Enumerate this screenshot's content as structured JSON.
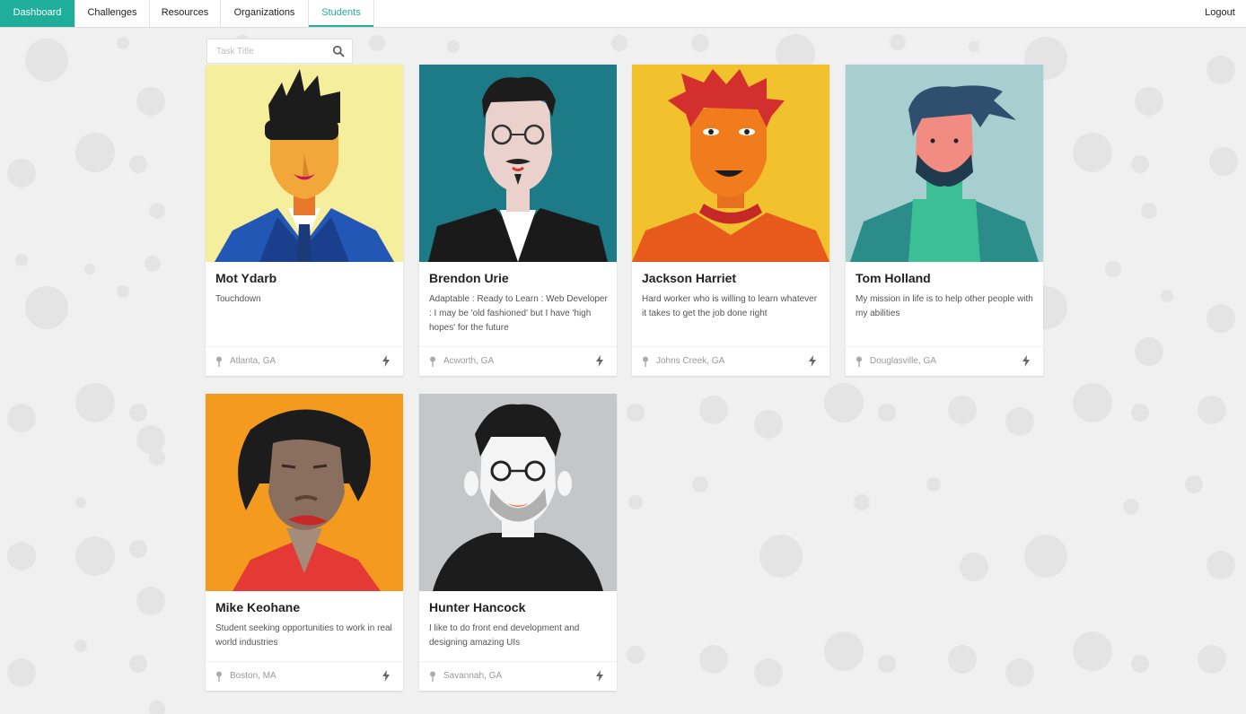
{
  "nav": {
    "items": [
      "Dashboard",
      "Challenges",
      "Resources",
      "Organizations",
      "Students"
    ],
    "logout": "Logout"
  },
  "colors": {
    "accent": "#1fae99",
    "background": "#f0f0f0",
    "dot": "#e4e4e4"
  },
  "search": {
    "placeholder": "Task Title",
    "icon": "search-icon"
  },
  "students": [
    {
      "name": "Mot Ydarb",
      "bio": "Touchdown",
      "location": "Atlanta, GA",
      "bg": "#f5ee9c"
    },
    {
      "name": "Brendon Urie",
      "bio": "Adaptable : Ready to Learn : Web Developer : I may be 'old fashioned' but I have 'high hopes' for the future",
      "location": "Acworth, GA",
      "bg": "#1d7a87"
    },
    {
      "name": "Jackson Harriet",
      "bio": "Hard worker who is willing to learn whatever it takes to get the job done right",
      "location": "Johns Creek, GA",
      "bg": "#f2c12e"
    },
    {
      "name": "Tom Holland",
      "bio": "My mission in life is to help other people with my abilities",
      "location": "Douglasville, GA",
      "bg": "#a8cfd0"
    },
    {
      "name": "Mike Keohane",
      "bio": "Student seeking opportunities to work in real world industries",
      "location": "Boston, MA",
      "bg": "#f39a1f"
    },
    {
      "name": "Hunter Hancock",
      "bio": "I like to do front end development and designing amazing UIs",
      "location": "Savannah, GA",
      "bg": "#c5c6c8"
    }
  ]
}
